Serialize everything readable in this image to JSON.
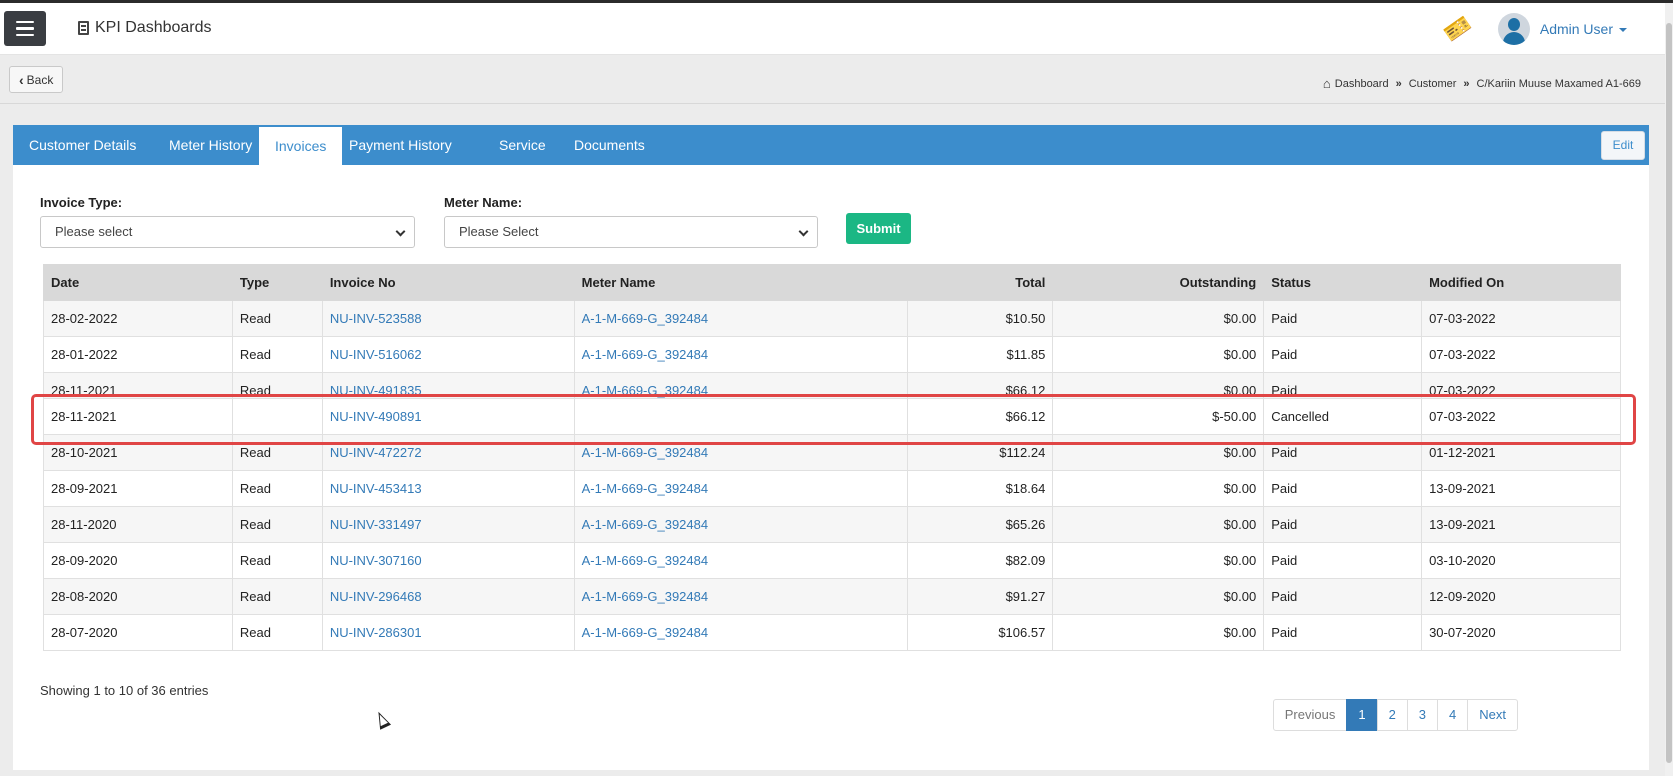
{
  "app": {
    "title": "KPI Dashboards"
  },
  "user": {
    "name": "Admin User"
  },
  "back_label": "Back",
  "breadcrumb": [
    "Dashboard",
    "Customer",
    "C/Kariin Muuse Maxamed A1-669"
  ],
  "tabs": [
    {
      "label": "Customer Details",
      "active": false
    },
    {
      "label": "Meter History",
      "active": false
    },
    {
      "label": "Invoices",
      "active": true
    },
    {
      "label": "Payment History",
      "active": false
    },
    {
      "label": "Service",
      "active": false
    },
    {
      "label": "Documents",
      "active": false
    }
  ],
  "edit_label": "Edit",
  "filters": {
    "invoice_type_label": "Invoice Type:",
    "invoice_type_value": "Please select",
    "meter_name_label": "Meter Name:",
    "meter_name_value": "Please Select",
    "submit_label": "Submit"
  },
  "table": {
    "columns": [
      "Date",
      "Type",
      "Invoice No",
      "Meter Name",
      "Total",
      "Outstanding",
      "Status",
      "Modified On"
    ],
    "rows": [
      [
        "28-02-2022",
        "Read",
        "NU-INV-523588",
        "A-1-M-669-G_392484",
        "$10.50",
        "$0.00",
        "Paid",
        "07-03-2022"
      ],
      [
        "28-01-2022",
        "Read",
        "NU-INV-516062",
        "A-1-M-669-G_392484",
        "$11.85",
        "$0.00",
        "Paid",
        "07-03-2022"
      ],
      [
        "28-11-2021",
        "Read",
        "NU-INV-491835",
        "A-1-M-669-G_392484",
        "$66.12",
        "$0.00",
        "Paid",
        "07-03-2022"
      ],
      [
        "28-11-2021",
        "",
        "NU-INV-490891",
        "",
        "$66.12",
        "$-50.00",
        "Cancelled",
        "07-03-2022"
      ],
      [
        "28-10-2021",
        "Read",
        "NU-INV-472272",
        "A-1-M-669-G_392484",
        "$112.24",
        "$0.00",
        "Paid",
        "01-12-2021"
      ],
      [
        "28-09-2021",
        "Read",
        "NU-INV-453413",
        "A-1-M-669-G_392484",
        "$18.64",
        "$0.00",
        "Paid",
        "13-09-2021"
      ],
      [
        "28-11-2020",
        "Read",
        "NU-INV-331497",
        "A-1-M-669-G_392484",
        "$65.26",
        "$0.00",
        "Paid",
        "13-09-2021"
      ],
      [
        "28-09-2020",
        "Read",
        "NU-INV-307160",
        "A-1-M-669-G_392484",
        "$82.09",
        "$0.00",
        "Paid",
        "03-10-2020"
      ],
      [
        "28-08-2020",
        "Read",
        "NU-INV-296468",
        "A-1-M-669-G_392484",
        "$91.27",
        "$0.00",
        "Paid",
        "12-09-2020"
      ],
      [
        "28-07-2020",
        "Read",
        "NU-INV-286301",
        "A-1-M-669-G_392484",
        "$106.57",
        "$0.00",
        "Paid",
        "30-07-2020"
      ]
    ]
  },
  "showing_text": "Showing 1 to 10 of 36 entries",
  "pagination": {
    "previous": "Previous",
    "pages": [
      "1",
      "2",
      "3",
      "4"
    ],
    "active_page": "1",
    "next": "Next"
  },
  "colors": {
    "tab_bar": "#3c8dcc",
    "link": "#337ab7",
    "submit": "#1bb784",
    "highlight_outline": "#e04545"
  }
}
